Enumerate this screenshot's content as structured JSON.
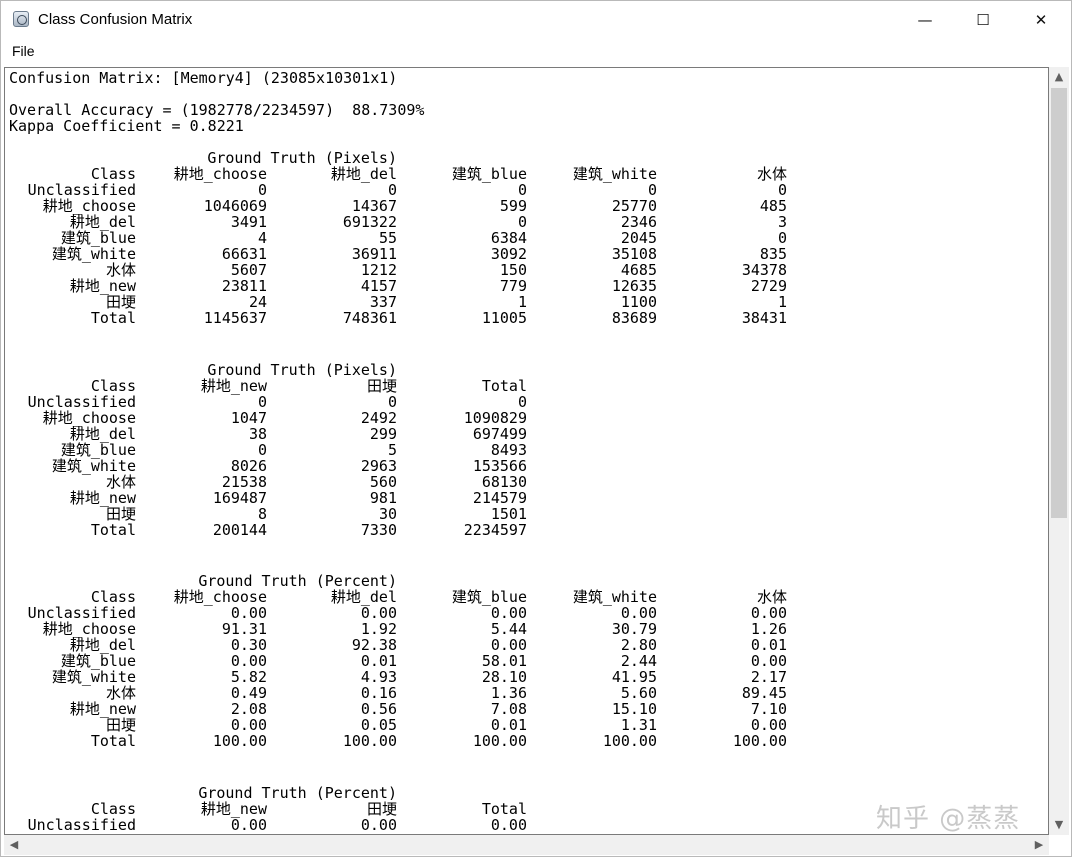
{
  "window": {
    "title": "Class Confusion Matrix",
    "icons": {
      "app": "app-icon",
      "minimize": "minimize-icon",
      "maximize": "maximize-icon",
      "close": "close-icon"
    },
    "controls": {
      "minimize": "—",
      "maximize": "☐",
      "close": "✕"
    }
  },
  "menu": {
    "file": "File"
  },
  "report": {
    "header": "Confusion Matrix: [Memory4] (23085x10301x1)",
    "accuracy": "Overall Accuracy = (1982778/2234597)  88.7309%",
    "kappa": "Kappa Coefficient = 0.8221",
    "tables": [
      {
        "title": "Ground Truth (Pixels)",
        "columns": [
          "Class",
          "耕地_choose",
          "耕地_del",
          "建筑_blue",
          "建筑_white",
          "水体"
        ],
        "rows": [
          [
            "Unclassified",
            "0",
            "0",
            "0",
            "0",
            "0"
          ],
          [
            "耕地_choose",
            "1046069",
            "14367",
            "599",
            "25770",
            "485"
          ],
          [
            "耕地_del",
            "3491",
            "691322",
            "0",
            "2346",
            "3"
          ],
          [
            "建筑_blue",
            "4",
            "55",
            "6384",
            "2045",
            "0"
          ],
          [
            "建筑_white",
            "66631",
            "36911",
            "3092",
            "35108",
            "835"
          ],
          [
            "水体",
            "5607",
            "1212",
            "150",
            "4685",
            "34378"
          ],
          [
            "耕地_new",
            "23811",
            "4157",
            "779",
            "12635",
            "2729"
          ],
          [
            "田埂",
            "24",
            "337",
            "1",
            "1100",
            "1"
          ],
          [
            "Total",
            "1145637",
            "748361",
            "11005",
            "83689",
            "38431"
          ]
        ]
      },
      {
        "title": "Ground Truth (Pixels)",
        "columns": [
          "Class",
          "耕地_new",
          "田埂",
          "Total"
        ],
        "rows": [
          [
            "Unclassified",
            "0",
            "0",
            "0"
          ],
          [
            "耕地_choose",
            "1047",
            "2492",
            "1090829"
          ],
          [
            "耕地_del",
            "38",
            "299",
            "697499"
          ],
          [
            "建筑_blue",
            "0",
            "5",
            "8493"
          ],
          [
            "建筑_white",
            "8026",
            "2963",
            "153566"
          ],
          [
            "水体",
            "21538",
            "560",
            "68130"
          ],
          [
            "耕地_new",
            "169487",
            "981",
            "214579"
          ],
          [
            "田埂",
            "8",
            "30",
            "1501"
          ],
          [
            "Total",
            "200144",
            "7330",
            "2234597"
          ]
        ]
      },
      {
        "title": "Ground Truth (Percent)",
        "columns": [
          "Class",
          "耕地_choose",
          "耕地_del",
          "建筑_blue",
          "建筑_white",
          "水体"
        ],
        "rows": [
          [
            "Unclassified",
            "0.00",
            "0.00",
            "0.00",
            "0.00",
            "0.00"
          ],
          [
            "耕地_choose",
            "91.31",
            "1.92",
            "5.44",
            "30.79",
            "1.26"
          ],
          [
            "耕地_del",
            "0.30",
            "92.38",
            "0.00",
            "2.80",
            "0.01"
          ],
          [
            "建筑_blue",
            "0.00",
            "0.01",
            "58.01",
            "2.44",
            "0.00"
          ],
          [
            "建筑_white",
            "5.82",
            "4.93",
            "28.10",
            "41.95",
            "2.17"
          ],
          [
            "水体",
            "0.49",
            "0.16",
            "1.36",
            "5.60",
            "89.45"
          ],
          [
            "耕地_new",
            "2.08",
            "0.56",
            "7.08",
            "15.10",
            "7.10"
          ],
          [
            "田埂",
            "0.00",
            "0.05",
            "0.01",
            "1.31",
            "0.00"
          ],
          [
            "Total",
            "100.00",
            "100.00",
            "100.00",
            "100.00",
            "100.00"
          ]
        ]
      },
      {
        "title": "Ground Truth (Percent)",
        "columns": [
          "Class",
          "耕地_new",
          "田埂",
          "Total"
        ],
        "rows": [
          [
            "Unclassified",
            "0.00",
            "0.00",
            "0.00"
          ]
        ]
      }
    ]
  },
  "scrollbars": {
    "up": "▲",
    "down": "▼",
    "left": "◀",
    "right": "▶",
    "icons": {
      "up": "scroll-up-arrow-icon",
      "down": "scroll-down-arrow-icon",
      "left": "scroll-left-arrow-icon",
      "right": "scroll-right-arrow-icon"
    }
  },
  "watermark": "知乎 @蒸蒸"
}
